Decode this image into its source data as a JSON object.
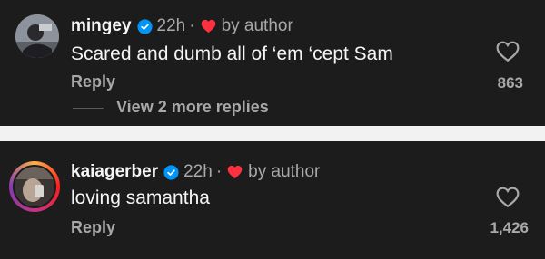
{
  "comments": [
    {
      "username": "mingey",
      "time": "22h",
      "separator": "·",
      "by_author": "by author",
      "text": "Scared and dumb all of ‘em ‘cept Sam",
      "reply_label": "Reply",
      "likes": "863",
      "view_replies": "View 2 more replies",
      "avatar_icon": "profile-photo"
    },
    {
      "username": "kaiagerber",
      "time": "22h",
      "separator": "·",
      "by_author": "by author",
      "text": "loving samantha",
      "reply_label": "Reply",
      "likes": "1,426",
      "avatar_icon": "profile-photo-story-ring"
    }
  ],
  "colors": {
    "background": "#1c1c1c",
    "verified": "#0095f6",
    "heart": "#ff3040",
    "secondary_text": "#a8a8a8"
  }
}
